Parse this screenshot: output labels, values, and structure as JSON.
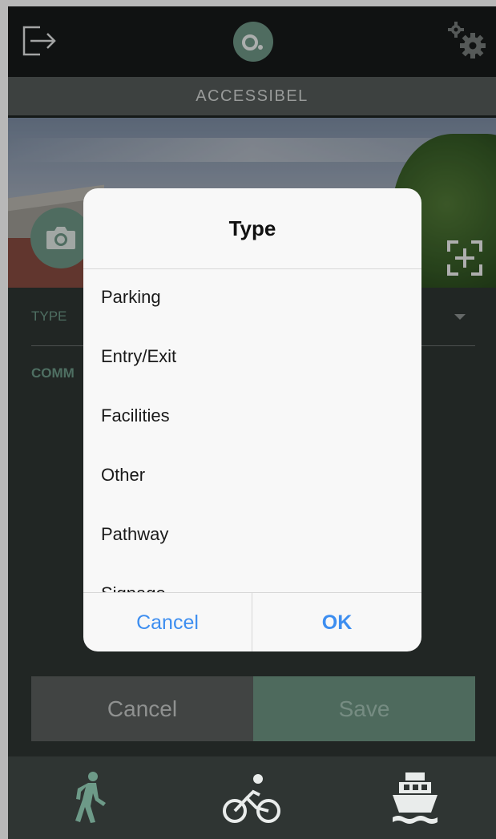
{
  "app": {
    "title": "ACCESSIBEL"
  },
  "topbar": {
    "left_icon": "logout-icon",
    "center_icon": "app-logo-icon",
    "right_icon": "settings-gears-icon"
  },
  "photo": {
    "camera_icon": "camera-icon",
    "scan_icon": "scan-add-icon"
  },
  "form": {
    "type_label": "TYPE",
    "comment_label": "COMM"
  },
  "actions": {
    "cancel_label": "Cancel",
    "save_label": "Save"
  },
  "dialog": {
    "title": "Type",
    "options": [
      "Parking",
      "Entry/Exit",
      "Facilities",
      "Other",
      "Pathway",
      "Signage"
    ],
    "cancel_label": "Cancel",
    "ok_label": "OK"
  },
  "tabs": [
    {
      "icon": "walking-icon",
      "active": true
    },
    {
      "icon": "cycling-icon",
      "active": false
    },
    {
      "icon": "ferry-icon",
      "active": false
    }
  ],
  "colors": {
    "accent": "#6d9a88",
    "link_blue": "#3d8ef0",
    "background": "#2f3533",
    "topbar": "#171a19"
  }
}
